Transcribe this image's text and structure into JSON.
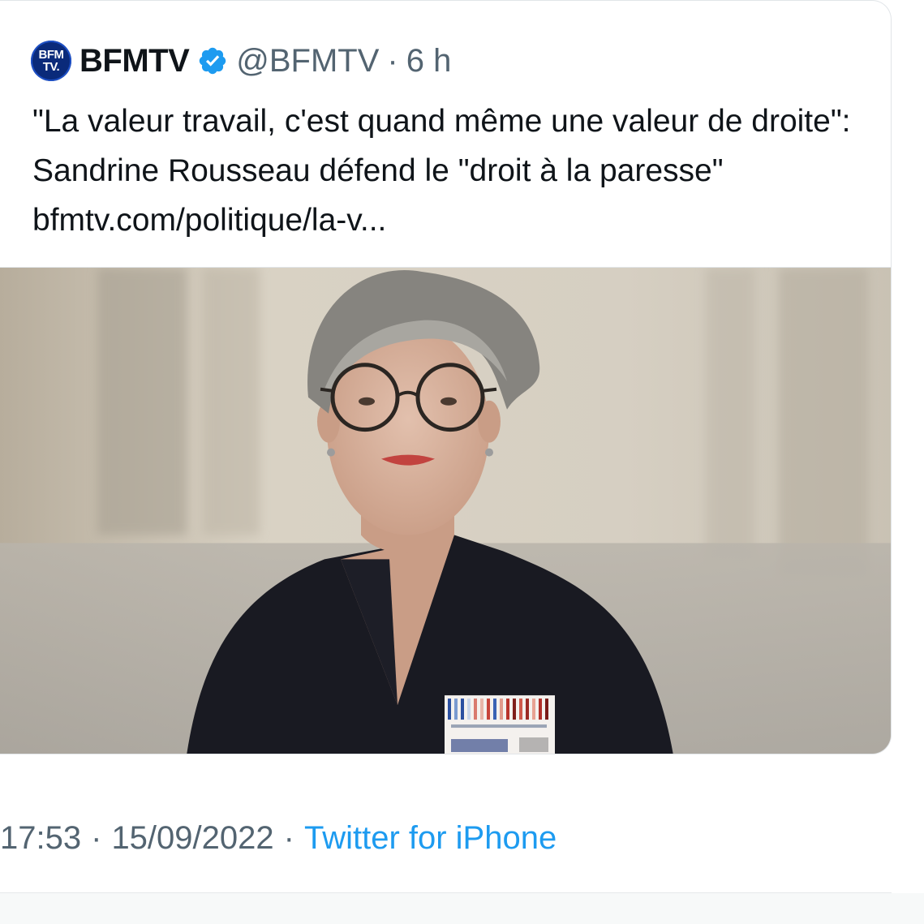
{
  "quoted_tweet": {
    "avatar_text_line1": "BFM",
    "avatar_text_line2": "TV.",
    "display_name": "BFMTV",
    "handle": "@BFMTV",
    "separator": "·",
    "time_ago": "6 h",
    "text": "\"La valeur travail, c'est quand même une valeur de droite\": Sandrine Rousseau défend le \"droit à la paresse\" bfmtv.com/politique/la-v...",
    "image_alt": "Photo of a woman with short grey hair and round glasses"
  },
  "meta": {
    "time": "17:53",
    "sep1": "·",
    "date": "15/09/2022",
    "sep2": "·",
    "source": "Twitter for iPhone"
  },
  "colors": {
    "accent": "#1d9bf0",
    "secondary_text": "#536471",
    "verified": "#1d9bf0"
  }
}
